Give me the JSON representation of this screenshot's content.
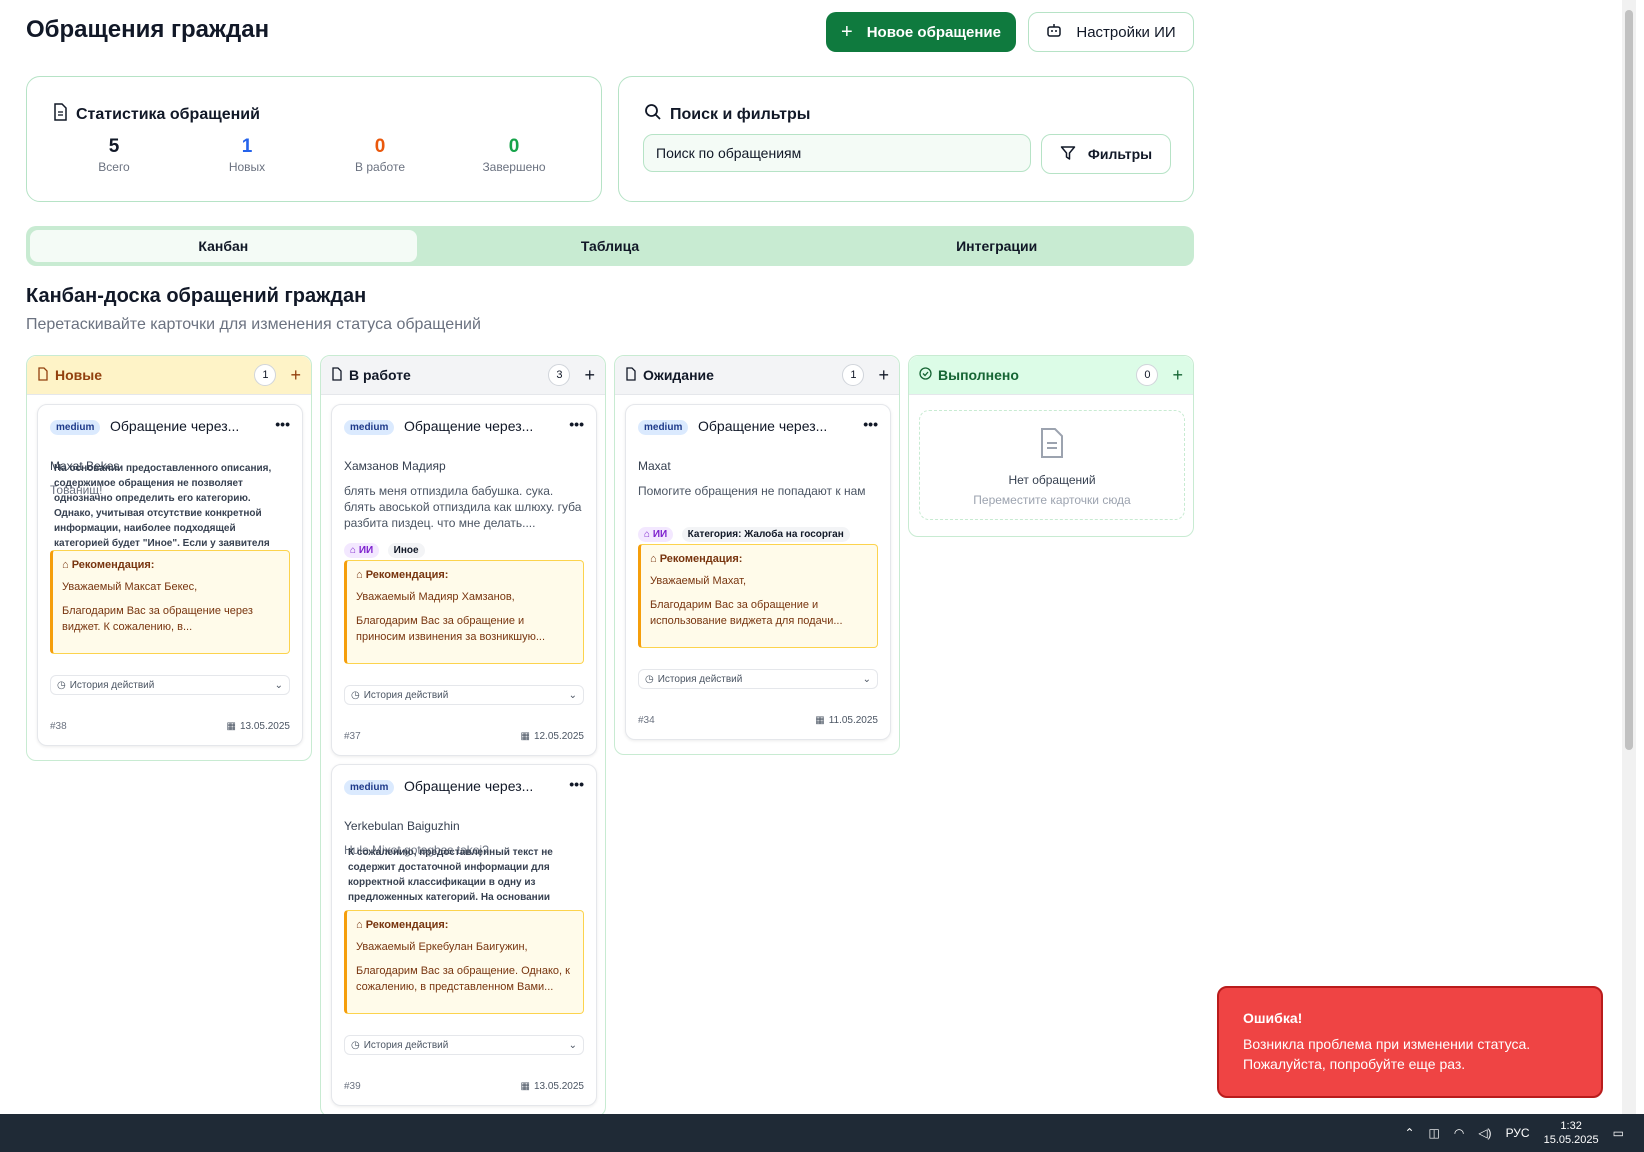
{
  "header": {
    "title": "Обращения граждан",
    "new_button": "Новое обращение",
    "ai_settings_button": "Настройки ИИ"
  },
  "stats": {
    "title": "Статистика обращений",
    "items": [
      {
        "value": "5",
        "label": "Всего",
        "color": "#111827"
      },
      {
        "value": "1",
        "label": "Новых",
        "color": "#2563eb"
      },
      {
        "value": "0",
        "label": "В работе",
        "color": "#ea580c"
      },
      {
        "value": "0",
        "label": "Завершено",
        "color": "#16a34a"
      }
    ]
  },
  "search": {
    "title": "Поиск и фильтры",
    "placeholder": "Поиск по обращениям",
    "filters_button": "Фильтры"
  },
  "tabs": [
    "Канбан",
    "Таблица",
    "Интеграции"
  ],
  "board": {
    "title": "Канбан-доска обращений граждан",
    "subtitle": "Перетаскивайте карточки для изменения статуса обращений"
  },
  "columns": [
    {
      "title": "Новые",
      "count": "1",
      "head_bg": "#fef3c7",
      "head_color": "#92400e",
      "cards": [
        {
          "priority": "medium",
          "title": "Обращение через...",
          "author": "Maxat Bekes",
          "overlay": "На основании предоставленного описания, содержимое обращения не позволяет однозначно определить его категорию. Однако, учитывая отсутствие конкретной информации, наиболее подходящей категорией будет \"Иное\". Если у заявителя",
          "overlay_under": "Тованищ!",
          "rec_title": "Рекомендация:",
          "rec_line1": "Уважаемый Максат Бекес,",
          "rec_line2": "Благодарим Вас за обращение через виджет. К сожалению, в...",
          "history": "История действий",
          "id": "#38",
          "date": "13.05.2025"
        }
      ]
    },
    {
      "title": "В работе",
      "count": "3",
      "head_bg": "#f3f4f6",
      "head_color": "#111827",
      "cards": [
        {
          "priority": "medium",
          "title": "Обращение через...",
          "author": "Хамзанов Мадияр",
          "desc": "блять меня отпиздила бабушка. сука. блять авоськой отпиздила как шлюху. губа разбита пиздец. что мне делать....",
          "tags": [
            "ИИ",
            "Иное"
          ],
          "rec_title": "Рекомендация:",
          "rec_line1": "Уважаемый Мадияр Хамзанов,",
          "rec_line2": "Благодарим Вас за обращение и приносим извинения за возникшую...",
          "history": "История действий",
          "id": "#37",
          "date": "12.05.2025"
        },
        {
          "priority": "medium",
          "title": "Обращение через...",
          "author": "Yerkebulan Baiguzhin",
          "desc": "Hule Mixot gotagbas takoj?",
          "overlay": "К сожалению, предоставленный текст не содержит достаточной информации для корректной классификации в одну из предложенных категорий. На основании имеющихся данных, данное обращение",
          "tags": [
            "ИИ"
          ],
          "rec_title": "Рекомендация:",
          "rec_line1": "Уважаемый Еркебулан Баигужин,",
          "rec_line2": "Благодарим Вас за обращение. Однако, к сожалению, в представленном Вами...",
          "history": "История действий",
          "id": "#39",
          "date": "13.05.2025"
        }
      ]
    },
    {
      "title": "Ожидание",
      "count": "1",
      "head_bg": "#f3f4f6",
      "head_color": "#111827",
      "cards": [
        {
          "priority": "medium",
          "title": "Обращение через...",
          "author": "Maxat",
          "desc": "Помогите обращения не попадают к нам",
          "tags": [
            "ИИ",
            "Категория: Жалоба на госорган"
          ],
          "rec_title": "Рекомендация:",
          "rec_line1": "Уважаемый Махат,",
          "rec_line2": "Благодарим Вас за обращение и использование виджета для подачи...",
          "history": "История действий",
          "id": "#34",
          "date": "11.05.2025"
        }
      ]
    },
    {
      "title": "Выполнено",
      "count": "0",
      "head_bg": "#dcfce7",
      "head_color": "#166534",
      "empty_title": "Нет обращений",
      "empty_hint": "Переместите карточки сюда"
    }
  ],
  "toast": {
    "title": "Ошибка!",
    "message": "Возникла проблема при изменении статуса. Пожалуйста, попробуйте еще раз."
  },
  "taskbar": {
    "language": "РУС",
    "time": "1:32",
    "date": "15.05.2025"
  }
}
